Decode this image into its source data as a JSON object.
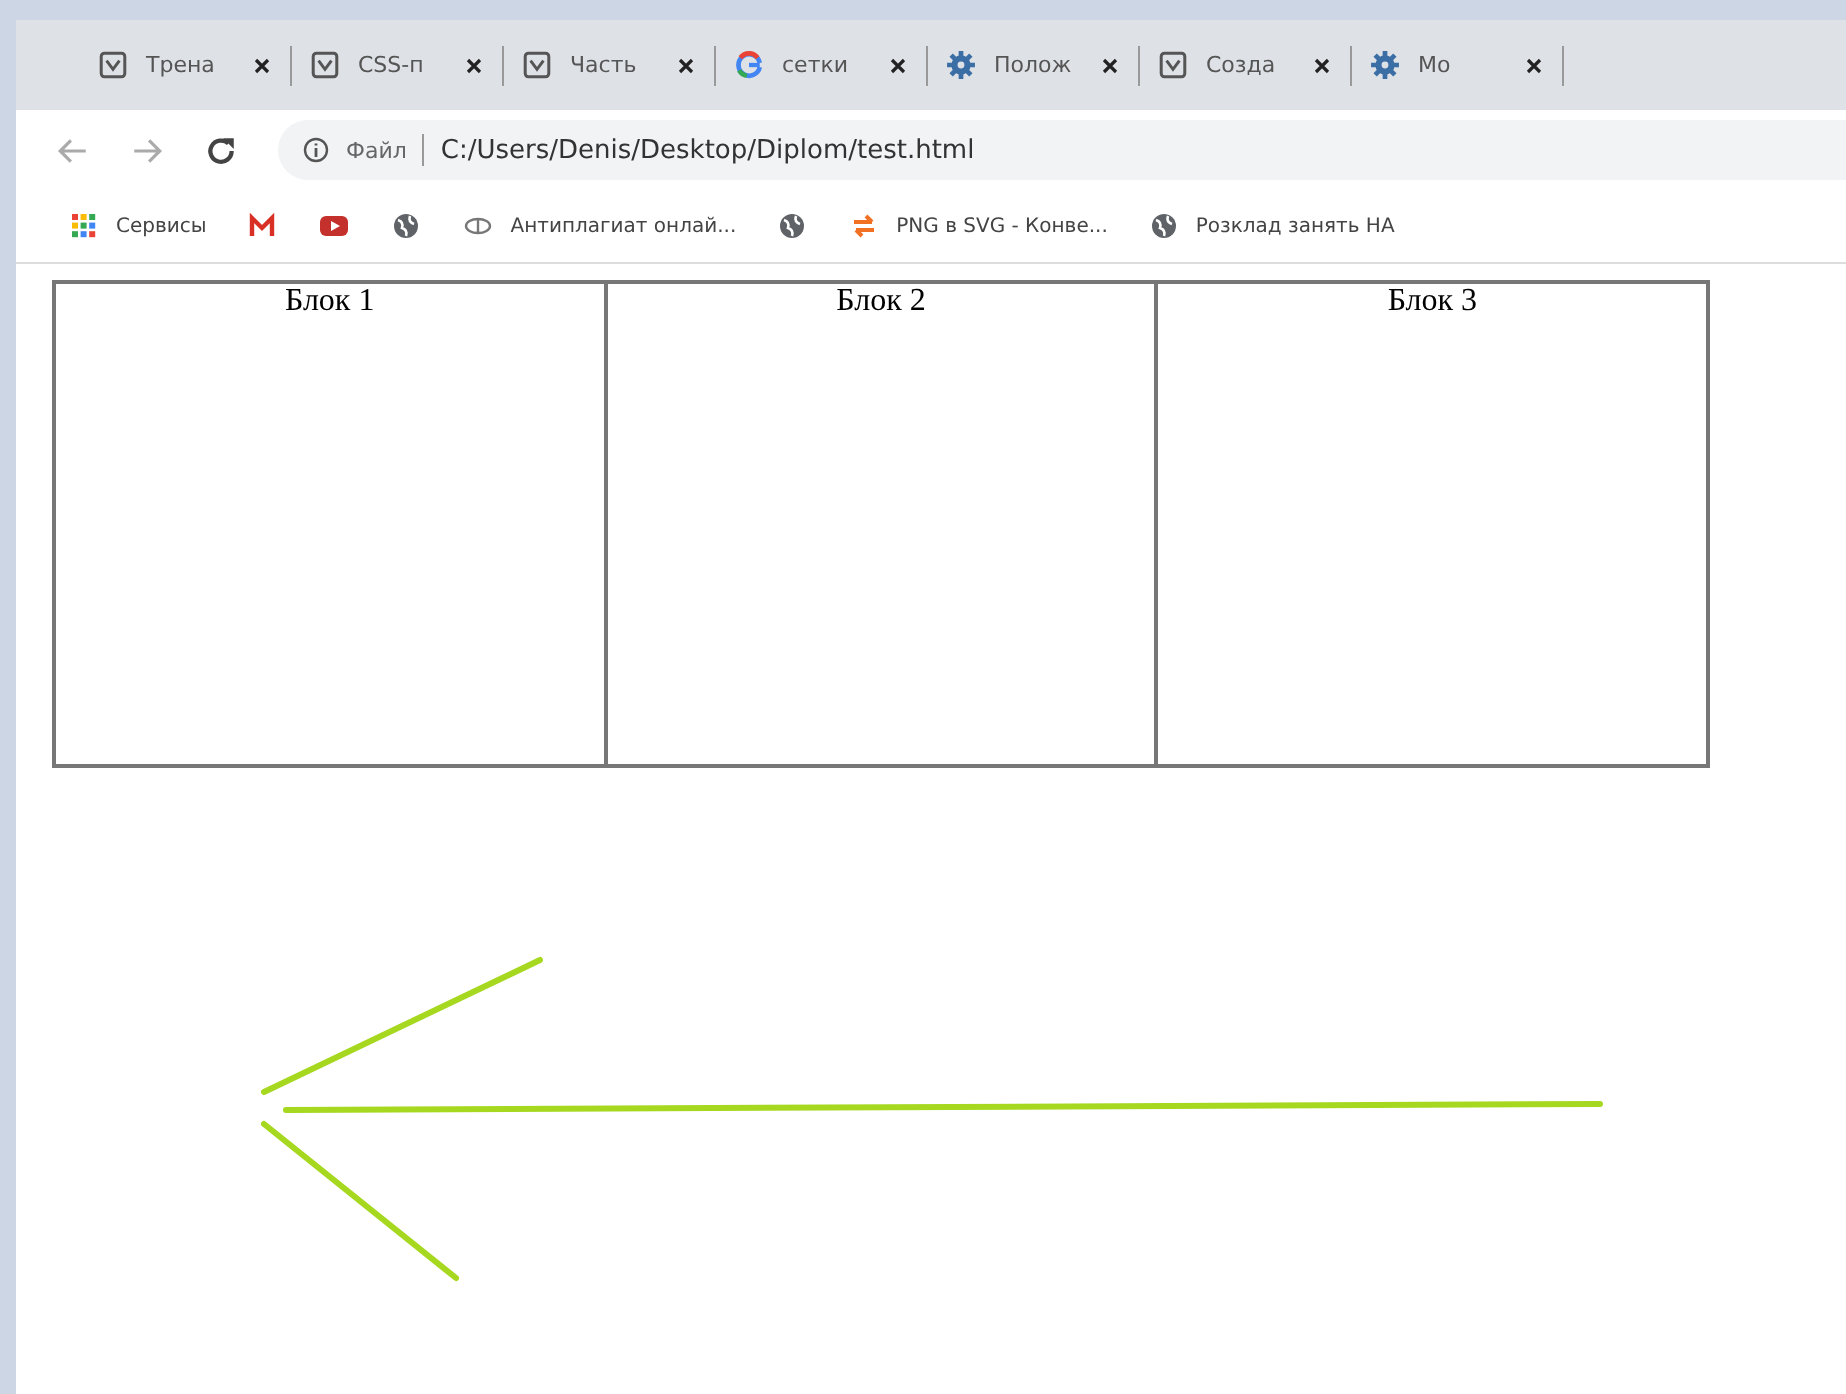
{
  "tabs": [
    {
      "title": "Трена",
      "kind": "page",
      "selected": false
    },
    {
      "title": "CSS-п",
      "kind": "page",
      "selected": false
    },
    {
      "title": "Часть",
      "kind": "page",
      "selected": false
    },
    {
      "title": "сетки",
      "kind": "google",
      "selected": false
    },
    {
      "title": "Полож",
      "kind": "gear",
      "selected": false
    },
    {
      "title": "Созда",
      "kind": "page",
      "selected": false
    },
    {
      "title": "Мо",
      "kind": "gear",
      "selected": false
    }
  ],
  "address_bar": {
    "scheme_label": "Файл",
    "url": "C:/Users/Denis/Desktop/Diplom/test.html"
  },
  "bookmarks": [
    {
      "kind": "apps",
      "label": "Сервисы"
    },
    {
      "kind": "gmail"
    },
    {
      "kind": "youtube"
    },
    {
      "kind": "globe"
    },
    {
      "kind": "link",
      "label": "Антиплагиат онлай..."
    },
    {
      "kind": "globe"
    },
    {
      "kind": "swap",
      "label": "PNG в SVG - Конве..."
    },
    {
      "kind": "globe",
      "label": "Розклад занять НА"
    }
  ],
  "page": {
    "blocks": [
      "Блок 1",
      "Блок 2",
      "Блок 3"
    ],
    "arrow": {
      "color": "#a6d820"
    }
  }
}
